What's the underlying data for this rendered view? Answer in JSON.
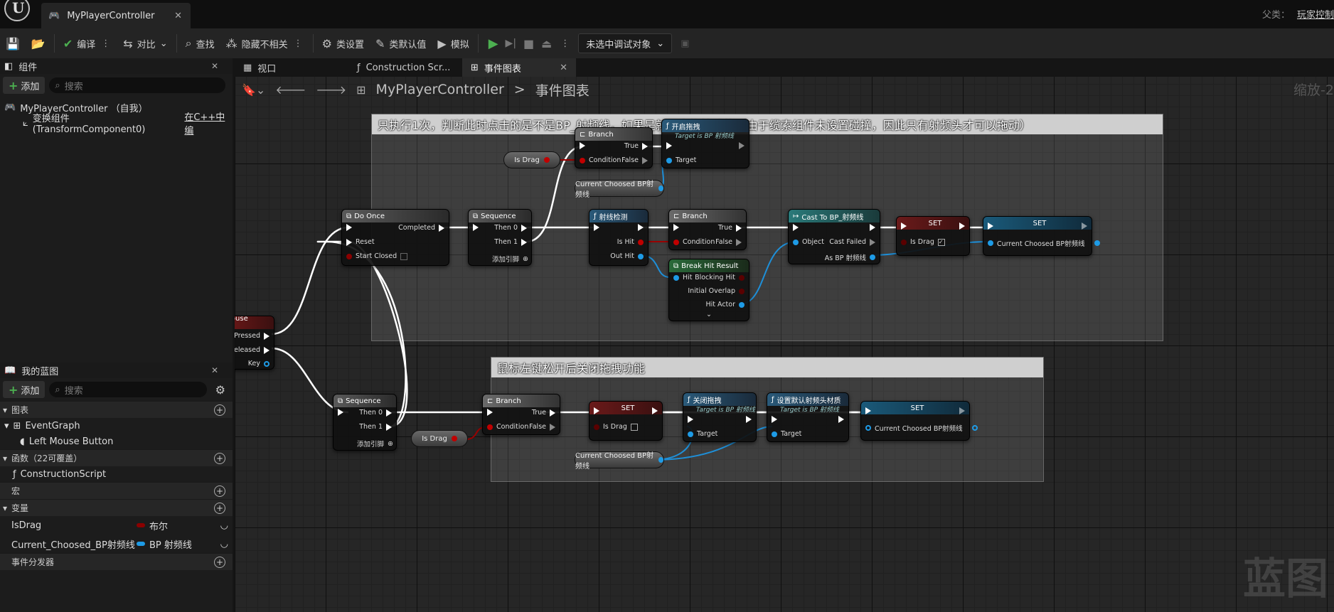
{
  "window": {
    "tab_title": "MyPlayerController",
    "parent_label": "父类：",
    "parent_link": "玩家控制"
  },
  "toolbar": {
    "compile": "编译",
    "diff": "对比",
    "find": "查找",
    "hide_unrelated": "隐藏不相关",
    "class_settings": "类设置",
    "class_defaults": "类默认值",
    "simulate": "模拟",
    "debug_select": "未选中调试对象"
  },
  "components": {
    "tab": "组件",
    "add": "添加",
    "search_placeholder": "搜索",
    "root": "MyPlayerController （自我）",
    "child": "变换组件 (TransformComponent0)",
    "child_link": "在C++中编"
  },
  "my_blueprint": {
    "tab": "我的蓝图",
    "add": "添加",
    "search_placeholder": "搜索",
    "graphs": "图表",
    "event_graph": "EventGraph",
    "event_item": "Left Mouse Button",
    "functions": "函数（22可覆盖）",
    "construction": "ConstructionScript",
    "macros": "宏",
    "variables": "变量",
    "var1_name": "IsDrag",
    "var1_type": "布尔",
    "var2_name": "Current_Choosed_BP射频线",
    "var2_type": "BP 射频线",
    "dispatchers": "事件分发器",
    "colors": {
      "bool": "#8b0000",
      "object": "#1e9be6"
    }
  },
  "graph_tabs": {
    "viewport": "视口",
    "construction": "Construction Scr...",
    "event_graph": "事件图表"
  },
  "breadcrumb": {
    "root": "MyPlayerController",
    "sep": ">",
    "current": "事件图表",
    "zoom": "缩放-2"
  },
  "comments": {
    "top": "只执行1次，判断此时点击的是不是BP_射频线，如果是就开启拖拽功能（由于缆索组件未设置碰撞，因此只有射频头才可以拖动）",
    "bottom": "鼠标左键松开后关闭拖拽功能"
  },
  "nodes": {
    "lmb": {
      "title": "Left Mouse Button",
      "pressed": "Pressed",
      "released": "Released",
      "key": "Key"
    },
    "do_once": {
      "title": "Do Once",
      "completed": "Completed",
      "reset": "Reset",
      "start_closed": "Start Closed"
    },
    "seq1": {
      "title": "Sequence",
      "then0": "Then 0",
      "then1": "Then 1",
      "add": "添加引脚"
    },
    "branch1": {
      "title": "Branch",
      "true": "True",
      "condition": "Condition",
      "false": "False"
    },
    "isdrag1": {
      "label": "Is Drag"
    },
    "start_drag": {
      "title": "开启拖拽",
      "sub": "Target is BP 射频线",
      "target": "Target"
    },
    "current1": {
      "label": "Current Choosed BP射频线"
    },
    "trace": {
      "title": "射线检测",
      "is_hit": "Is Hit",
      "out_hit": "Out Hit"
    },
    "branch2": {
      "title": "Branch",
      "true": "True",
      "condition": "Condition",
      "false": "False"
    },
    "break_hit": {
      "title": "Break Hit Result",
      "hit": "Hit",
      "blocking": "Blocking Hit",
      "overlap": "Initial Overlap",
      "actor": "Hit Actor",
      "more": "⌄"
    },
    "cast": {
      "title": "Cast To BP_射频线",
      "object": "Object",
      "failed": "Cast Failed",
      "as": "As BP 射频线"
    },
    "set1": {
      "title": "SET",
      "label": "Is Drag"
    },
    "set2": {
      "title": "SET",
      "label": "Current Choosed BP射频线"
    },
    "seq2": {
      "title": "Sequence",
      "then0": "Then 0",
      "then1": "Then 1",
      "add": "添加引脚"
    },
    "isdrag2": {
      "label": "Is Drag"
    },
    "branch3": {
      "title": "Branch",
      "true": "True",
      "condition": "Condition",
      "false": "False"
    },
    "set3": {
      "title": "SET",
      "label": "Is Drag"
    },
    "stop_drag": {
      "title": "关闭拖拽",
      "sub": "Target is BP 射频线",
      "target": "Target"
    },
    "reset_mat": {
      "title": "设置默认射频头材质",
      "sub": "Target is BP 射频线",
      "target": "Target"
    },
    "set4": {
      "title": "SET",
      "label": "Current Choosed BP射频线"
    },
    "current2": {
      "label": "Current Choosed BP射频线"
    }
  },
  "watermark": "蓝图"
}
